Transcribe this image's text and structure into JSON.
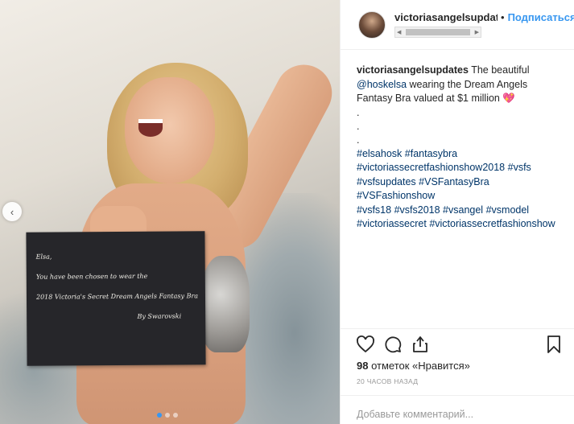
{
  "media": {
    "letter_lines": [
      "Elsa,",
      "You have been chosen to wear the",
      "2018 Victoria's Secret Dream Angels Fantasy Bra",
      "By Swarovski"
    ],
    "prev_arrow": "‹",
    "carousel_count": 3,
    "carousel_active_index": 0
  },
  "header": {
    "username": "victoriasangelsupdates",
    "separator": "•",
    "follow_label": "Подписаться"
  },
  "caption": {
    "username": "victoriasangelsupdates",
    "text_1": " The beautiful ",
    "mention": "@hoskelsa",
    "text_2": " wearing the Dream Angels Fantasy Bra valued at $1 million ",
    "emoji": "💖",
    "dots": [
      ".",
      ".",
      "."
    ],
    "hashtags": [
      "#elsahosk",
      "#fantasybra",
      "#victoriassecretfashionshow2018",
      "#vsfs",
      "#vsfsupdates",
      "#VSFantasyBra",
      "#VSFashionshow",
      "#vsfs18",
      "#vsfs2018",
      "#vsangel",
      "#vsmodel",
      "#victoriassecret",
      "#victoriassecretfashionshow"
    ]
  },
  "actions": {
    "icons": [
      "heart-icon",
      "comment-icon",
      "share-icon",
      "bookmark-icon"
    ],
    "likes_count": "98",
    "likes_text": " отметок «Нравится»",
    "timestamp": "20 часов назад"
  },
  "comment": {
    "placeholder": "Добавьте комментарий..."
  },
  "colors": {
    "link": "#003569",
    "follow": "#3897f0",
    "border": "#efefef",
    "muted": "#999999"
  }
}
